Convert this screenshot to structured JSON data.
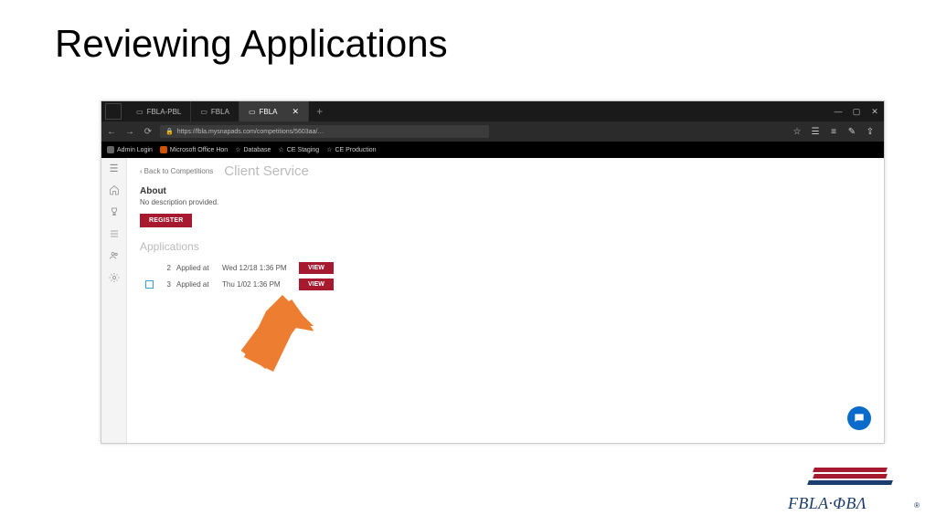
{
  "slide": {
    "title": "Reviewing Applications"
  },
  "tabs": [
    {
      "label": "FBLA-PBL"
    },
    {
      "label": "FBLA"
    },
    {
      "label": "FBLA"
    }
  ],
  "url": "https://fbla.mysnapads.com/competitions/5603aa/…",
  "bookmarks": [
    {
      "label": "Admin Login",
      "color": "#666"
    },
    {
      "label": "Microsoft Office Hon",
      "color": "#d35400"
    },
    {
      "label": "Database",
      "icon": "star"
    },
    {
      "label": "CE Staging",
      "icon": "star"
    },
    {
      "label": "CE Production",
      "icon": "star"
    }
  ],
  "page": {
    "back_label": "Back to Competitions",
    "title": "Client Service",
    "about_heading": "About",
    "about_text": "No description provided.",
    "register_label": "REGISTER",
    "applications_heading": "Applications",
    "applications": [
      {
        "num": "2",
        "label": "Applied at",
        "date": "Wed 12/18 1:36 PM",
        "view": "VIEW",
        "checkbox": false
      },
      {
        "num": "3",
        "label": "Applied at",
        "date": "Thu 1/02 1:36 PM",
        "view": "VIEW",
        "checkbox": true
      }
    ]
  },
  "logo": {
    "text": "FBLA·ΦBΛ"
  },
  "colors": {
    "accent": "#a6192e",
    "navy": "#1b3d6d",
    "arrow": "#ed7d31"
  }
}
